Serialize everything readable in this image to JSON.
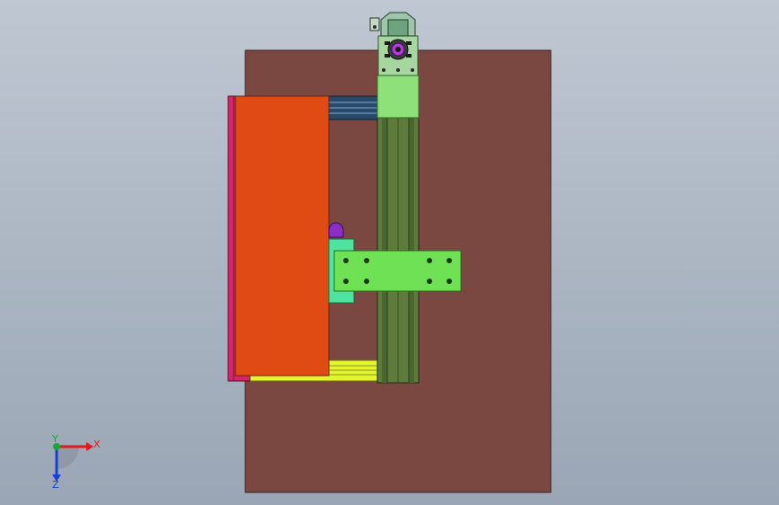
{
  "window": {
    "title": ""
  },
  "viewport": {
    "background_top": "#bfc7d2",
    "background_bottom": "#9aa6b5"
  },
  "model": {
    "base_plate_color": "#7b4741",
    "module_orange_color": "#e04b14",
    "rail_green_color": "#5e7b3c",
    "carriage_green_color": "#6ee254",
    "bracket_teal_color": "#4ee4a0",
    "motor_block_color": "#8ee07b",
    "yellow_rail_color": "#e3f531",
    "navy_rail_color": "#274a6b",
    "magenta_edge_color": "#d8246a"
  },
  "triad": {
    "x_label": "X",
    "y_label": "Y",
    "z_label": "Z",
    "x_color": "#e01a1a",
    "y_color": "#19a63a",
    "z_color": "#1a3fd6"
  }
}
